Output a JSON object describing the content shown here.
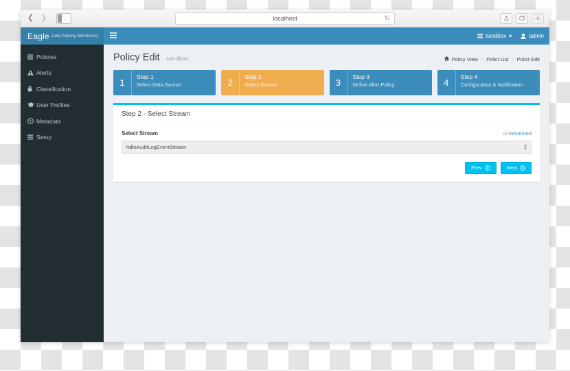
{
  "browser": {
    "url": "localhost",
    "back_icon": "chevron-left-icon",
    "forward_icon": "chevron-right-icon",
    "sidebar_icon": "sidebar-toggle-icon",
    "reload_icon": "reload-icon",
    "share_icon": "share-icon",
    "tabs_icon": "tabs-overview-icon",
    "newtab_label": "+"
  },
  "sidebar": {
    "brand": {
      "name": "Eagle",
      "subtitle": "Data Activity Monitoring"
    },
    "items": [
      {
        "label": "Policies",
        "icon": "list-bars-icon"
      },
      {
        "label": "Alerts",
        "icon": "warning-triangle-icon"
      },
      {
        "label": "Classification",
        "icon": "lock-icon"
      },
      {
        "label": "User Profiles",
        "icon": "graduation-cap-icon"
      },
      {
        "label": "Metadata",
        "icon": "globe-icon"
      },
      {
        "label": "Setup",
        "icon": "list-bars-icon"
      }
    ]
  },
  "topbar": {
    "menu_icon": "hamburger-icon",
    "site": {
      "label": "sandbox",
      "icon": "building-icon",
      "caret": "▾"
    },
    "user": {
      "label": "admin",
      "icon": "user-icon"
    }
  },
  "page": {
    "title": "Policy Edit",
    "subtitle": "sandbox",
    "breadcrumb": {
      "home_icon": "home-icon",
      "items": [
        "Policy View",
        "Polict List",
        "Polict Edit"
      ],
      "separator": "›"
    }
  },
  "steps": [
    {
      "num": "1",
      "title": "Step 1",
      "sub": "Select Data Source",
      "state": "inactive"
    },
    {
      "num": "2",
      "title": "Step 2",
      "sub": "Select Stream",
      "state": "active"
    },
    {
      "num": "3",
      "title": "Step 3",
      "sub": "Define Alert Policy",
      "state": "inactive"
    },
    {
      "num": "4",
      "title": "Step 4",
      "sub": "Configuration & Notification",
      "state": "inactive"
    }
  ],
  "panel": {
    "title": "Step 2 - Select Stream",
    "field_label": "Select Stream",
    "advanced_prefix": "or ",
    "advanced_link": "Advanced",
    "select_value": "hdfsAuditLogEventStream",
    "buttons": {
      "prev": "Prev",
      "next": "Next"
    }
  },
  "colors": {
    "brand_blue": "#3c8dbc",
    "brand_blue_dark": "#367fa9",
    "sidebar_dark": "#222d32",
    "accent_orange": "#f0ad4e",
    "accent_cyan": "#00c0ef",
    "page_bg": "#ecf0f5"
  }
}
